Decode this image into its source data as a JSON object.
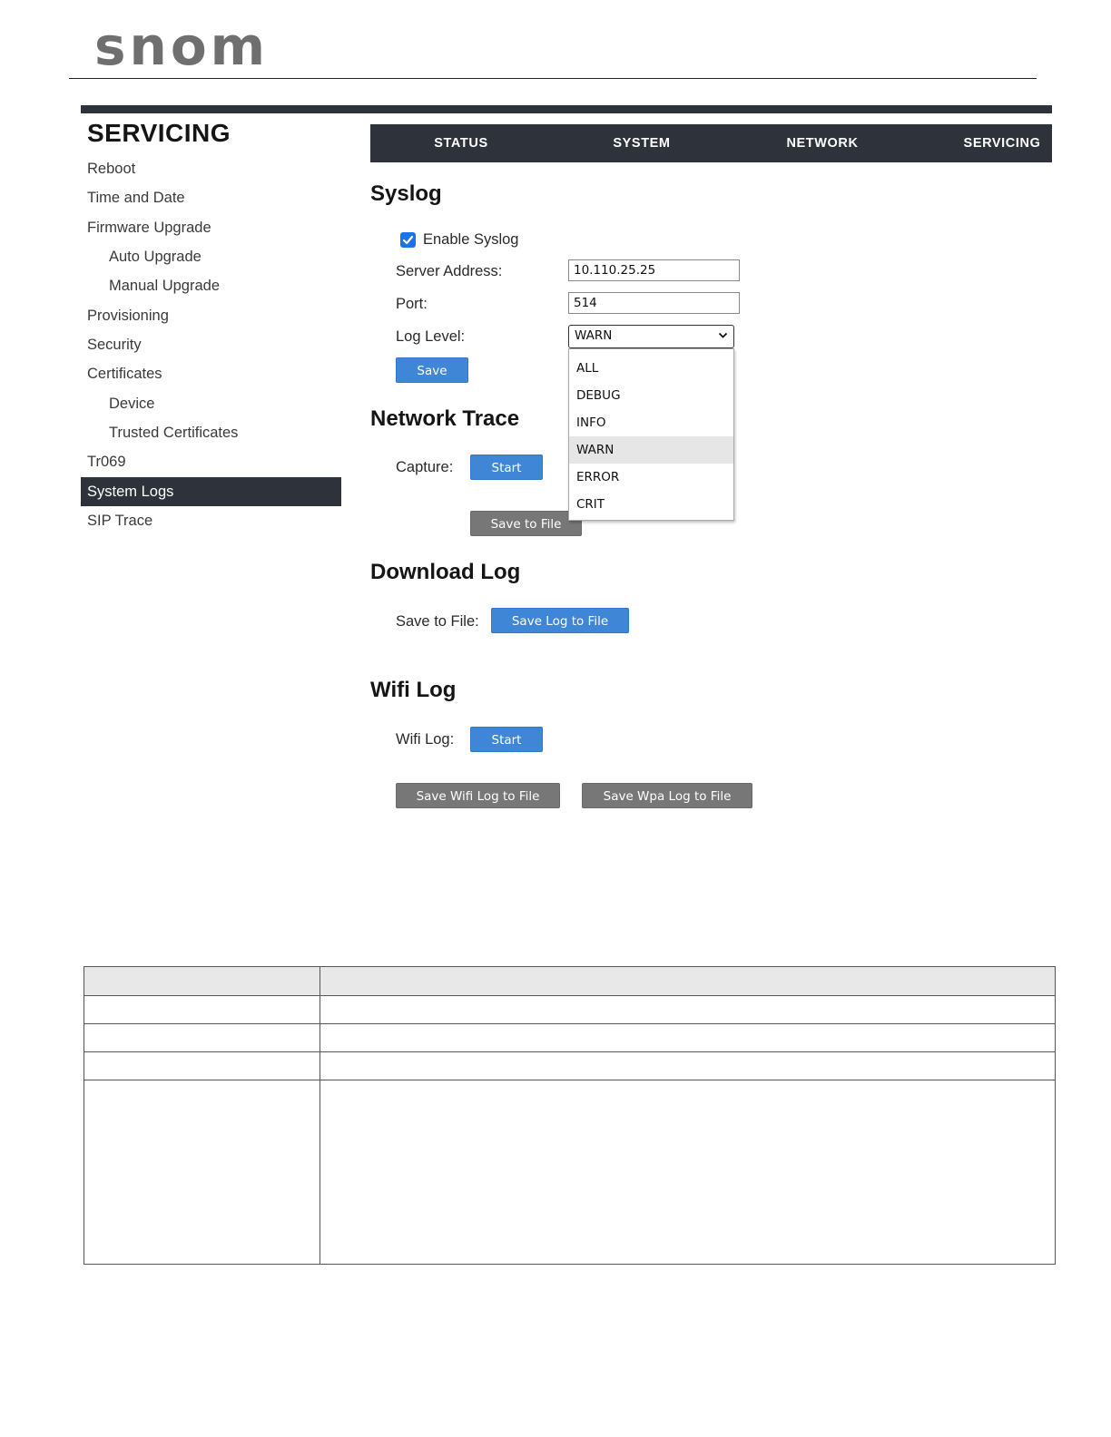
{
  "logo": {
    "text": "snom"
  },
  "sidebar": {
    "title": "SERVICING",
    "items": [
      {
        "label": "Reboot"
      },
      {
        "label": "Time and Date"
      },
      {
        "label": "Firmware Upgrade"
      },
      {
        "label": "Auto Upgrade"
      },
      {
        "label": "Manual Upgrade"
      },
      {
        "label": "Provisioning"
      },
      {
        "label": "Security"
      },
      {
        "label": "Certificates"
      },
      {
        "label": "Device"
      },
      {
        "label": "Trusted Certificates"
      },
      {
        "label": "Tr069"
      },
      {
        "label": "System Logs"
      },
      {
        "label": "SIP Trace"
      }
    ],
    "active": "System Logs"
  },
  "topnav": {
    "tabs": [
      {
        "label": "STATUS"
      },
      {
        "label": "SYSTEM"
      },
      {
        "label": "NETWORK"
      },
      {
        "label": "SERVICING"
      }
    ]
  },
  "syslog": {
    "title": "Syslog",
    "enable_label": "Enable Syslog",
    "enabled": true,
    "server_label": "Server Address:",
    "server_value": "10.110.25.25",
    "port_label": "Port:",
    "port_value": "514",
    "loglevel_label": "Log Level:",
    "loglevel_value": "WARN",
    "loglevel_options": [
      "ALL",
      "DEBUG",
      "INFO",
      "WARN",
      "ERROR",
      "CRIT"
    ],
    "save_label": "Save"
  },
  "network_trace": {
    "title": "Network Trace",
    "capture_label": "Capture:",
    "start_label": "Start",
    "save_file_label": "Save to File"
  },
  "download_log": {
    "title": "Download Log",
    "save_label": "Save to File:",
    "button_label": "Save Log to File"
  },
  "wifi_log": {
    "title": "Wifi Log",
    "label": "Wifi Log:",
    "start_label": "Start",
    "save_wifi_label": "Save Wifi Log to File",
    "save_wpa_label": "Save Wpa Log to File"
  },
  "colors": {
    "nav_bg": "#2e323a",
    "button_blue": "#3f86d6",
    "button_gray": "#777777",
    "checkbox": "#1a73e8"
  }
}
